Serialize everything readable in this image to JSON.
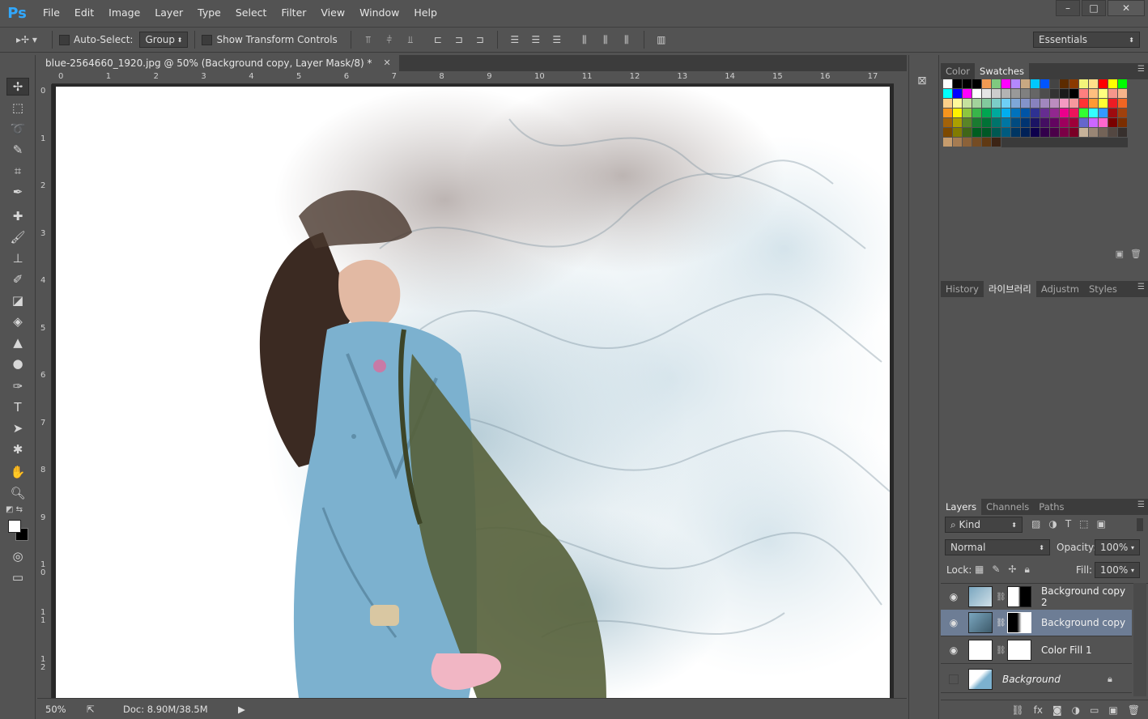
{
  "app": {
    "logo": "Ps"
  },
  "menu": [
    "File",
    "Edit",
    "Image",
    "Layer",
    "Type",
    "Select",
    "Filter",
    "View",
    "Window",
    "Help"
  ],
  "window_controls": [
    "–",
    "□",
    "✕"
  ],
  "options": {
    "auto_select_label": "Auto-Select:",
    "auto_select_value": "Group",
    "show_transform_label": "Show Transform Controls",
    "workspace": "Essentials"
  },
  "document": {
    "tab_title": "blue-2564660_1920.jpg @ 50% (Background copy, Layer Mask/8) *",
    "h_ruler": [
      "0",
      "1",
      "2",
      "3",
      "4",
      "5",
      "6",
      "7",
      "8",
      "9",
      "10",
      "11",
      "12",
      "13",
      "14",
      "15",
      "16",
      "17"
    ],
    "v_ruler": [
      "0",
      "1",
      "2",
      "3",
      "4",
      "5",
      "6",
      "7",
      "8",
      "9",
      "1 0",
      "1 1",
      "1 2"
    ]
  },
  "status": {
    "zoom": "50%",
    "doc_size": "Doc: 8.90M/38.5M"
  },
  "color_panel": {
    "tabs": [
      "Color",
      "Swatches"
    ],
    "active": "Swatches",
    "swatch_colors": [
      "#ffffff",
      "#000000",
      "#000000",
      "#000000",
      "#f19a52",
      "#7fc97f",
      "#ff00ff",
      "#b388ff",
      "#c8a882",
      "#00c8ff",
      "#0055ff",
      "#444444",
      "#5c2b00",
      "#8b3a00",
      "#f3f37a",
      "#ffe08a",
      "#ff0000",
      "#ffff00",
      "#00ff00",
      "#00ffff",
      "#0000ff",
      "#ff00ff",
      "#ffffff",
      "#e6e6e6",
      "#cccccc",
      "#b3b3b3",
      "#999999",
      "#808080",
      "#666666",
      "#4d4d4d",
      "#333333",
      "#1a1a1a",
      "#000000",
      "#ff7f7f",
      "#ffbf7f",
      "#ffff7f",
      "#f6968b",
      "#f8b48a",
      "#fccf89",
      "#fff99b",
      "#c5e19e",
      "#a2d39c",
      "#82ca9d",
      "#7bcdc8",
      "#6ecff6",
      "#7ea7d8",
      "#8493ca",
      "#8882be",
      "#a187be",
      "#bc8dbf",
      "#f49ac2",
      "#f6989d",
      "#ff3333",
      "#ff9933",
      "#ffff33",
      "#ed1c24",
      "#f26522",
      "#f7941d",
      "#fff200",
      "#8dc63f",
      "#39b54a",
      "#00a651",
      "#00a99d",
      "#00aeef",
      "#0072bc",
      "#0054a6",
      "#2e3192",
      "#662d91",
      "#92278f",
      "#ec008c",
      "#ed145b",
      "#33ff33",
      "#33ffff",
      "#3399ff",
      "#9e0b0f",
      "#a0410d",
      "#a36209",
      "#aba000",
      "#598527",
      "#1a7b30",
      "#007236",
      "#00746b",
      "#0076a3",
      "#004b80",
      "#003471",
      "#1b1464",
      "#440e62",
      "#630460",
      "#9e005d",
      "#9e0039",
      "#6666cc",
      "#cc66ff",
      "#ff66cc",
      "#790000",
      "#7b2e00",
      "#7d4900",
      "#827b00",
      "#406618",
      "#005e20",
      "#005826",
      "#005952",
      "#005b7f",
      "#003663",
      "#002157",
      "#0d004c",
      "#32004b",
      "#4b0049",
      "#7b0046",
      "#7a0026",
      "#c7b299",
      "#998675",
      "#736357",
      "#534741",
      "#37302d",
      "#c69c6d",
      "#a67c52",
      "#8c6239",
      "#754c24",
      "#603913",
      "#3c2415"
    ]
  },
  "library_panel": {
    "tabs": [
      "History",
      "라이브러리",
      "Adjustm",
      "Styles"
    ],
    "active": "라이브러리"
  },
  "layers_panel": {
    "tabs": [
      "Layers",
      "Channels",
      "Paths"
    ],
    "active": "Layers",
    "filter": "Kind",
    "blend_mode": "Normal",
    "opacity_label": "Opacity:",
    "opacity": "100%",
    "lock_label": "Lock:",
    "fill_label": "Fill:",
    "fill": "100%",
    "layers": [
      {
        "name": "Background copy 2",
        "visible": true,
        "selected": false
      },
      {
        "name": "Background copy",
        "visible": true,
        "selected": true
      },
      {
        "name": "Color Fill 1",
        "visible": true,
        "selected": false
      },
      {
        "name": "Background",
        "visible": false,
        "selected": false,
        "locked": true
      }
    ]
  }
}
